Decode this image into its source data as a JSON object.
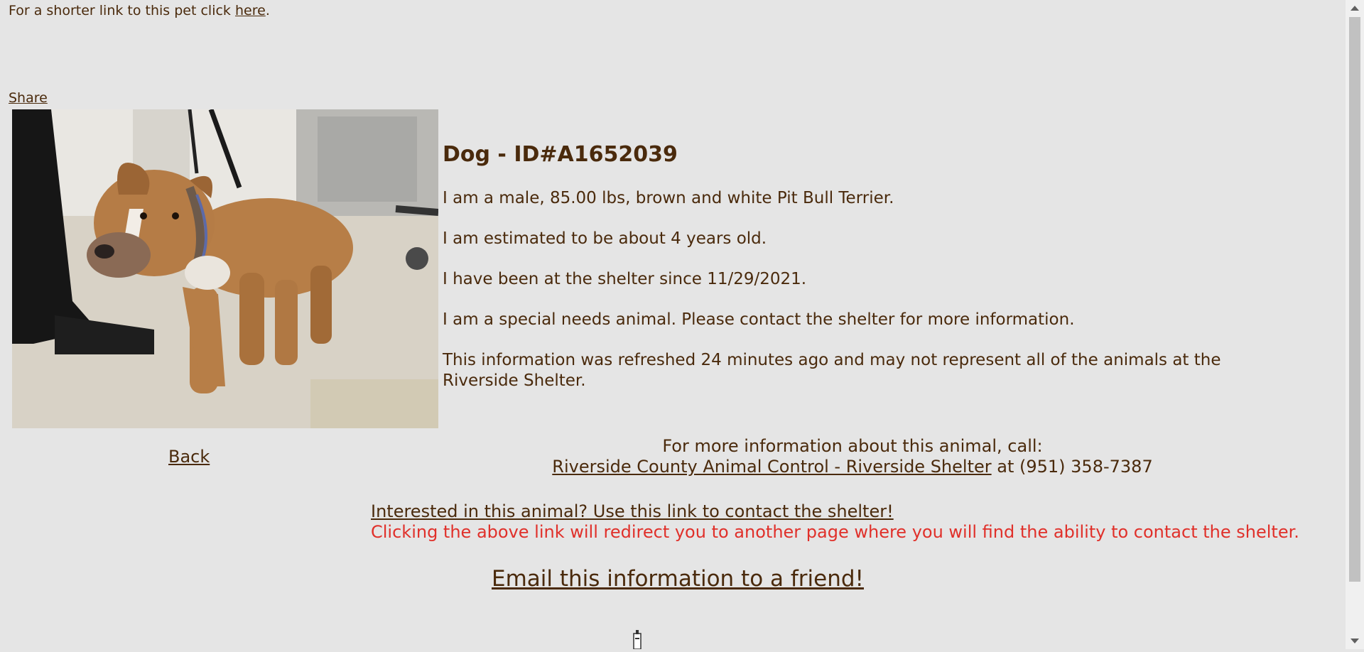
{
  "top": {
    "shorter_link_text": "For a shorter link to this pet click ",
    "here_link": "here",
    "period": "."
  },
  "share_link": "Share",
  "photo": {
    "icon": "dog-photo"
  },
  "back_link": "Back",
  "animal": {
    "title": "Dog - ID#A1652039",
    "line1": "I am a male, 85.00 lbs, brown and white Pit Bull Terrier.",
    "line2": "I am estimated to be about 4 years old.",
    "line3": "I have been at the shelter since 11/29/2021.",
    "line4": "I am a special needs animal. Please contact the shelter for more information.",
    "line5": "This information was refreshed 24 minutes ago and may not represent all of the animals at the Riverside Shelter."
  },
  "contact": {
    "heading": "For more information about this animal, call:",
    "shelter_link": "Riverside County Animal Control - Riverside Shelter",
    "phone_text": " at (951) 358-7387"
  },
  "interest": {
    "link": "Interested in this animal? Use this link to contact the shelter!",
    "warning": "Clicking the above link will redirect you to another page where you will find the ability to contact the shelter."
  },
  "email_link": "Email this information to a friend!",
  "colors": {
    "background": "#e5e5e5",
    "text": "#4a2a0c",
    "warning": "#e0302a"
  }
}
